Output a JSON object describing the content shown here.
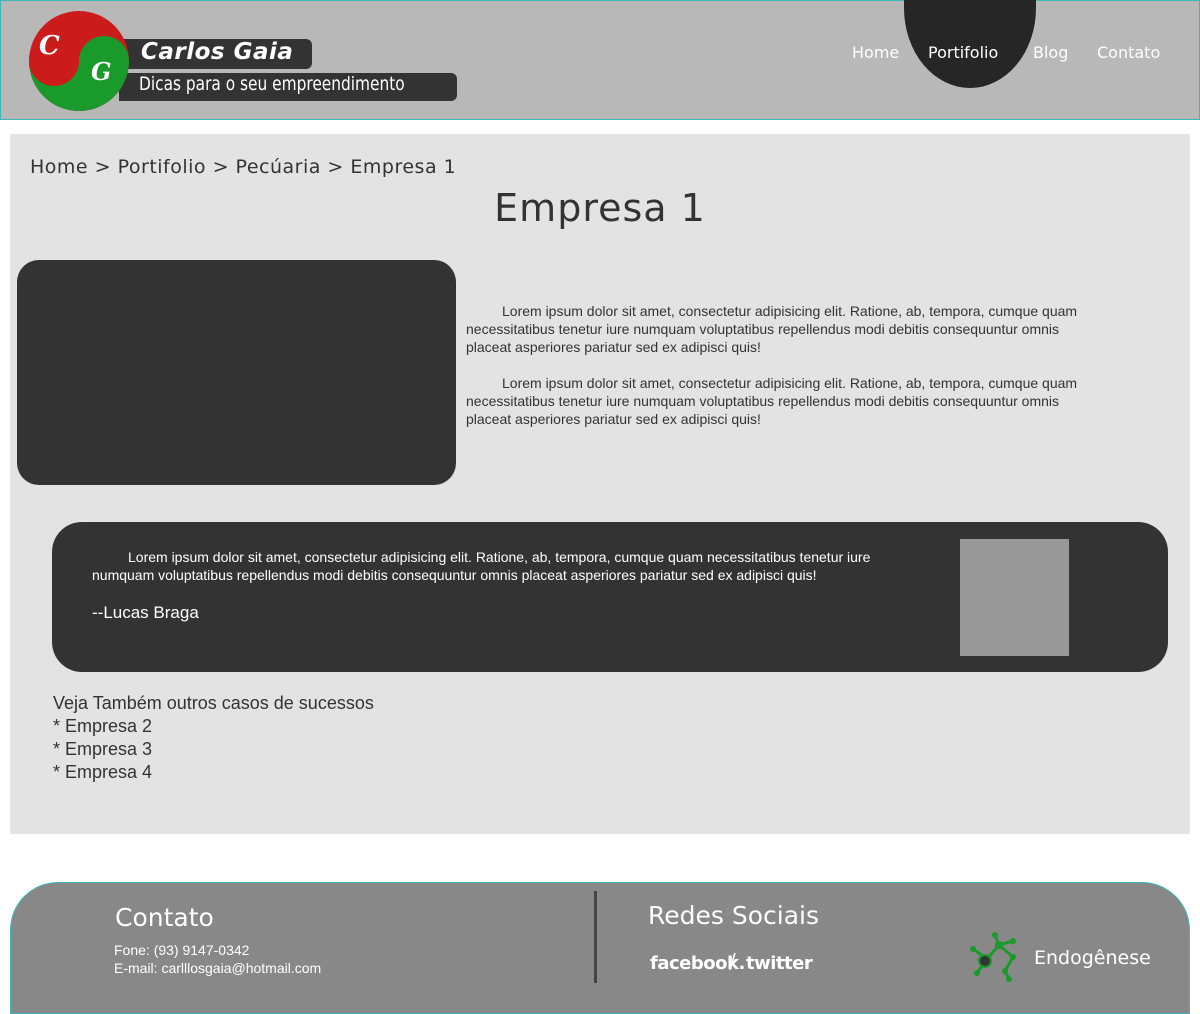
{
  "header": {
    "logo": {
      "letter1": "C",
      "letter2": "G"
    },
    "brand_name": "Carlos Gaia",
    "tagline": "Dicas para o seu empreendimento",
    "nav": [
      "Home",
      "Portifolio",
      "Blog",
      "Contato"
    ],
    "active_nav": "Portifolio"
  },
  "main": {
    "breadcrumb": "Home > Portifolio > Pecúaria > Empresa 1",
    "title": "Empresa 1",
    "paragraphs": [
      "Lorem ipsum dolor sit amet, consectetur adipisicing elit. Ratione, ab, tempora, cumque quam necessitatibus tenetur iure numquam voluptatibus repellendus modi debitis consequuntur omnis placeat asperiores pariatur sed ex adipisci quis!",
      "Lorem ipsum dolor sit amet, consectetur adipisicing elit. Ratione, ab, tempora, cumque quam necessitatibus tenetur iure numquam voluptatibus repellendus modi debitis consequuntur omnis placeat asperiores pariatur sed ex adipisci quis!"
    ],
    "testimonial": {
      "text": "Lorem ipsum dolor sit amet, consectetur adipisicing elit. Ratione, ab, tempora, cumque quam necessitatibus tenetur iure numquam voluptatibus repellendus modi debitis consequuntur omnis placeat asperiores pariatur sed ex adipisci quis!",
      "author": "--Lucas Braga"
    },
    "see_also": {
      "heading": "Veja Também outros casos de sucessos",
      "items": [
        "* Empresa 2",
        "* Empresa 3",
        "* Empresa 4"
      ]
    }
  },
  "footer": {
    "contact_heading": "Contato",
    "phone": "Fone: (93) 9147-0342",
    "email": "E-mail: carlllosgaia@hotmail.com",
    "social_heading": "Redes Sociais",
    "facebook": "facebook.",
    "separator": "/",
    "twitter": "twitter",
    "credit": "Endogênese"
  },
  "colors": {
    "header_bg": "#b8b8b8",
    "accent_border": "#3cb8b8",
    "dark": "#333333",
    "main_bg": "#e3e3e3",
    "footer_bg": "#888888",
    "logo_red": "#cc1b1b",
    "logo_green": "#1a9a2a"
  }
}
